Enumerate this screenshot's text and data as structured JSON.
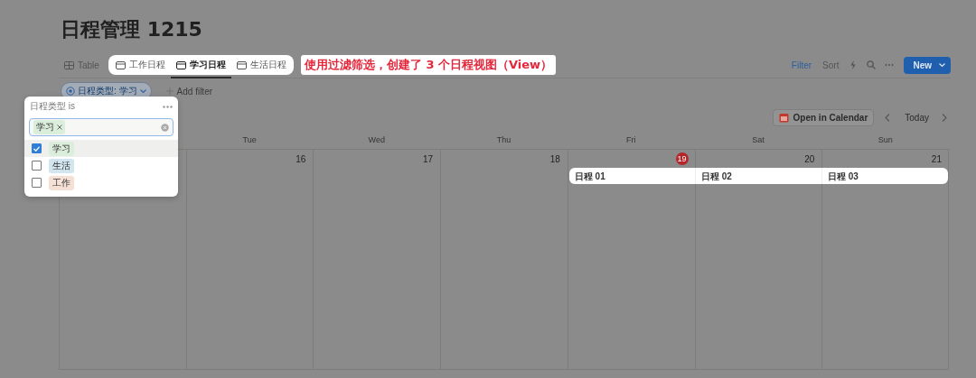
{
  "title": "日程管理 1215",
  "views": [
    {
      "label": "Table",
      "kind": "table",
      "selected": false
    },
    {
      "label": "工作日程",
      "kind": "calendar",
      "selected": false
    },
    {
      "label": "学习日程",
      "kind": "calendar",
      "selected": true
    },
    {
      "label": "生活日程",
      "kind": "calendar",
      "selected": false
    }
  ],
  "annotation": "使用过滤筛选，创建了 3 个日程视图（View）",
  "toolbar": {
    "filter": "Filter",
    "sort": "Sort",
    "new": "New"
  },
  "filter_chip": "日程类型: 学习",
  "add_filter": "Add filter",
  "calendar": {
    "open_in_calendar": "Open in Calendar",
    "today": "Today",
    "weekdays": [
      "Tue",
      "Wed",
      "Thu",
      "Fri",
      "Sat",
      "Sun"
    ],
    "days": [
      {
        "number": "16",
        "today": false
      },
      {
        "number": "17",
        "today": false
      },
      {
        "number": "18",
        "today": false
      },
      {
        "number": "19",
        "today": true
      },
      {
        "number": "20",
        "today": false
      },
      {
        "number": "21",
        "today": false
      }
    ],
    "events": [
      {
        "label": "日程 01"
      },
      {
        "label": "日程 02"
      },
      {
        "label": "日程 03"
      }
    ]
  },
  "popup": {
    "header": "日程类型 is",
    "tag": "学习",
    "options": [
      {
        "label": "学习",
        "checked": true,
        "selected": true,
        "color": "#dbeddb"
      },
      {
        "label": "生活",
        "checked": false,
        "selected": false,
        "color": "#d3e5ef"
      },
      {
        "label": "工作",
        "checked": false,
        "selected": false,
        "color": "#f5e0d6"
      }
    ]
  }
}
